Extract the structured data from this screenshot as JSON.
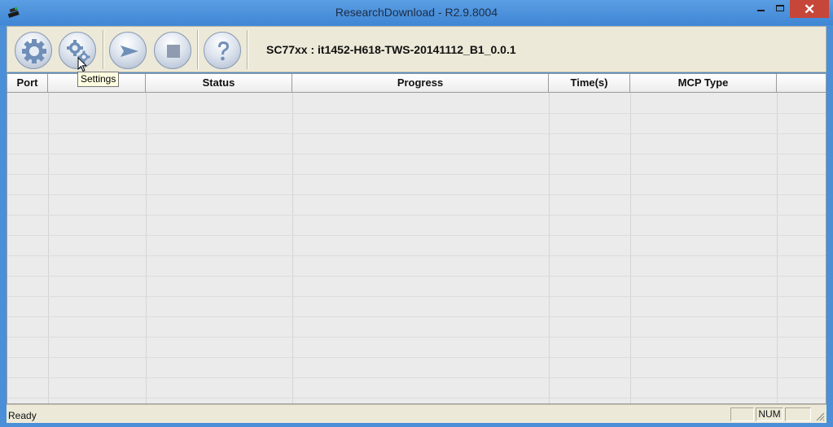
{
  "window": {
    "title": "ResearchDownload - R2.9.8004",
    "controls": {
      "minimize": "minimize",
      "maximize": "maximize",
      "close": "✕"
    }
  },
  "toolbar": {
    "buttons": [
      {
        "name": "load-packet",
        "icon": "gear-icon"
      },
      {
        "name": "settings",
        "icon": "gears-icon"
      },
      {
        "name": "start-download",
        "icon": "play-arrow-icon"
      },
      {
        "name": "stop-download",
        "icon": "stop-icon"
      },
      {
        "name": "about",
        "icon": "question-icon"
      }
    ],
    "file_label": "SC77xx : it1452-H618-TWS-20141112_B1_0.0.1"
  },
  "tooltip": {
    "text": "Settings"
  },
  "table": {
    "columns": [
      "Port",
      "",
      "Status",
      "Progress",
      "Time(s)",
      "MCP Type",
      ""
    ],
    "rows": []
  },
  "statusbar": {
    "text": "Ready",
    "indicators": [
      "",
      "NUM",
      ""
    ]
  },
  "colors": {
    "titlebar": "#4a8fd8",
    "toolbar": "#ece9d8",
    "table_bg": "#ebebeb",
    "close_button": "#c7463a",
    "tooltip_bg": "#ffffe1"
  }
}
